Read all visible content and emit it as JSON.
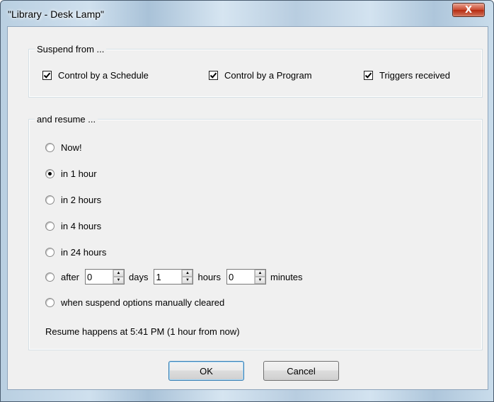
{
  "window": {
    "title": "\"Library - Desk Lamp\"",
    "close_label": "X"
  },
  "suspend": {
    "legend": "Suspend from ...",
    "options": [
      {
        "label": "Control by a Schedule",
        "checked": true
      },
      {
        "label": "Control by a Program",
        "checked": true
      },
      {
        "label": "Triggers received",
        "checked": true
      }
    ]
  },
  "resume": {
    "legend": "and resume ...",
    "options": [
      {
        "label": "Now!",
        "selected": false
      },
      {
        "label": "in 1 hour",
        "selected": true
      },
      {
        "label": "in 2 hours",
        "selected": false
      },
      {
        "label": "in 4 hours",
        "selected": false
      },
      {
        "label": "in 24 hours",
        "selected": false
      },
      {
        "label": "after",
        "selected": false
      },
      {
        "label": "when suspend options manually cleared",
        "selected": false
      }
    ],
    "after": {
      "days_value": "0",
      "days_label": "days",
      "hours_value": "1",
      "hours_label": "hours",
      "minutes_value": "0",
      "minutes_label": "minutes"
    },
    "status_text": "Resume happens at 5:41 PM (1 hour from now)"
  },
  "buttons": {
    "ok_label": "OK",
    "cancel_label": "Cancel"
  }
}
